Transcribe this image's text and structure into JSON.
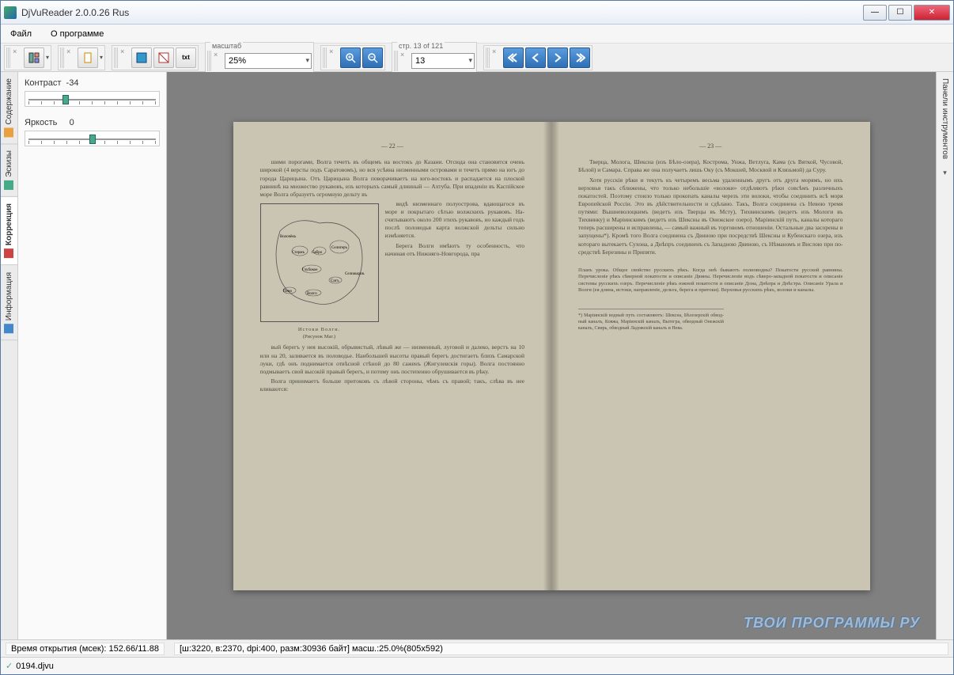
{
  "window": {
    "title": "DjVuReader 2.0.0.26 Rus"
  },
  "menu": {
    "file": "Файл",
    "about": "О программе"
  },
  "toolbar": {
    "zoom_label": "масштаб",
    "zoom_value": "25%",
    "page_label": "стр. 13 of 121",
    "page_value": "13"
  },
  "sidebar": {
    "tabs": [
      "Содержание",
      "Эскизы",
      "Коррекция",
      "Информация"
    ],
    "active_tab": 2,
    "contrast_label": "Контраст",
    "contrast_value": "-34",
    "brightness_label": "Яркость",
    "brightness_value": "0"
  },
  "right_panel": {
    "label": "Панели инструментов"
  },
  "document": {
    "left_page_num": "— 22 —",
    "right_page_num": "— 23 —",
    "map_caption_title": "Истоки Волги.",
    "map_caption_sub": "(Рисунок Маг.)",
    "map_labels": [
      "Волочёкъ",
      "Стержъ",
      "Сабро",
      "Селигеръ",
      "Глубокое",
      "Сигъ",
      "Селижаров.",
      "Пено",
      "Волго"
    ],
    "left_para1": "шими порогами, Волга течетъ въ общемъ на востокъ до Казани. Отсюда она становится очень широкой (4 вер­сты подъ Саратовомъ), но вся усѣяна низменными остро­вами и течетъ прямо на югъ до города Царицына. Отъ Царицына Волга поворачиваетъ на юго-востокъ и рас­падается на плоской равнинѣ на множество рукавовъ, изъ которыхъ самый длинный — Ахтуба. При впаденіи въ Каспійское море Волга образуетъ огромную дельту въ",
    "left_wrap": "видѣ низменнаго по­луострова, вдающа­гося въ море и по­крытаго сѣтью волж­скихъ рукавовъ. На­считываютъ около 200 этихъ рукавовъ, но каждый годъ послѣ половодья карта волж­ской дельты сильно измѣняется.",
    "left_wrap2": "Берега Волги имѣ­ютъ ту особенность, что начиная отъ Ниж­няго-Новгорода, пра­",
    "left_para2": "вый берегъ у нея высокій, обрывистый, лѣвый же — низ­менный, луговой и далеко, верстъ на 10 или на 20, заливается въ половодье. Наибольшей высоты правый берегъ достигаетъ близъ Самарской луки, гдѣ онъ подни­мается отвѣсной стѣной до 80 саженъ (Жигулевскія горы). Волга постоянно подмываетъ свой высокій правый бе­регъ, и потому онъ постепенно обрушивается въ рѣку.",
    "left_para3": "Волга принимаетъ больше притоковъ съ лѣвой сто­роны, чѣмъ съ правой; такъ, слѣва въ нее вливаются:",
    "right_para1": "Тверца, Молога, Шексна (изъ Бѣло-озера), Кострома, Унжа, Ветлуга, Кама (съ Вяткой, Чусовой, Бѣлой) и Самара. Справа же она получаетъ лишь Оку (съ Мок­шей, Москвой и Клязьмой) да Суру.",
    "right_para2": "Хотя русскія рѣки и текутъ къ четыремъ весьма уда­леннымъ другъ отъ друга морямъ, но ихъ верховья такъ сближены, что только небольшіе «волоки» отдѣляютъ рѣки совсѣмъ различныхъ покатостей. Поэтому стоило только прокопать каналы черезъ эти волоки, чтобы соеди­нить всѣ моря Европейской Россіи. Это въ дѣйствитель­ности и сдѣлано. Такъ, Волга соединена съ Невою тремя путями: Вышневолоцкимъ (ведетъ изъ Тверцы въ Мсту), Тихвинскимъ (ведетъ изъ Мологи въ Тихвинку) и Маріин­скимъ (ведетъ изъ Шексны въ Онежское озеро). Маріин­скій путь, каналы котораго теперь расширены и испра­влены, — самый важный въ торговомъ отношеніи. Осталь­ные два засорены и запущены*). Кромѣ того Волга со­единена съ Двиною при посредствѣ Шексны и Кубенскаго озера, изъ котораго вытекаетъ Сухона, а Днѣпръ соединенъ съ Западною Двиною, съ Нѣманомъ и Вислою при по­средствѣ Березины и Припяти.",
    "right_plan": "Планъ урока. Общее свойство русскихъ рѣкъ. Когда онѣ быва­ютъ полноводны? Покатости русской равнины. Перечисленіе рѣкъ сѣверной покатости и описаніе Двины. Перечисленіе водъ сѣверо-западной покатости и описаніе системы русскихъ озеръ. Перечи­сленіе рѣкъ южной покатости и описаніе Дона, Днѣпра и Днѣстра. Описаніе Урала и Волги (ея длина, истоки, направленіе, дельта, берега и притоки). Верховья русскихъ рѣкъ, волоки и каналы.",
    "right_footnote": "*) Маріинскій водный путь составляютъ: Шексна, Бѣлозерскій обвод­ный каналъ, Ковжа, Маріинскій каналъ, Вытегра, обводный Онежскій каналъ, Свирь, обводный Ладожскій каналъ и Нева."
  },
  "status": {
    "open_time": "Время открытия (мсек): 152.66/11.88",
    "dims": "[ш:3220, в:2370, dpi:400, разм:30936 байт] масш.:25.0%(805x592)"
  },
  "file": {
    "name": "0194.djvu"
  },
  "watermark": "ТВОИ ПРОГРАММЫ РУ"
}
